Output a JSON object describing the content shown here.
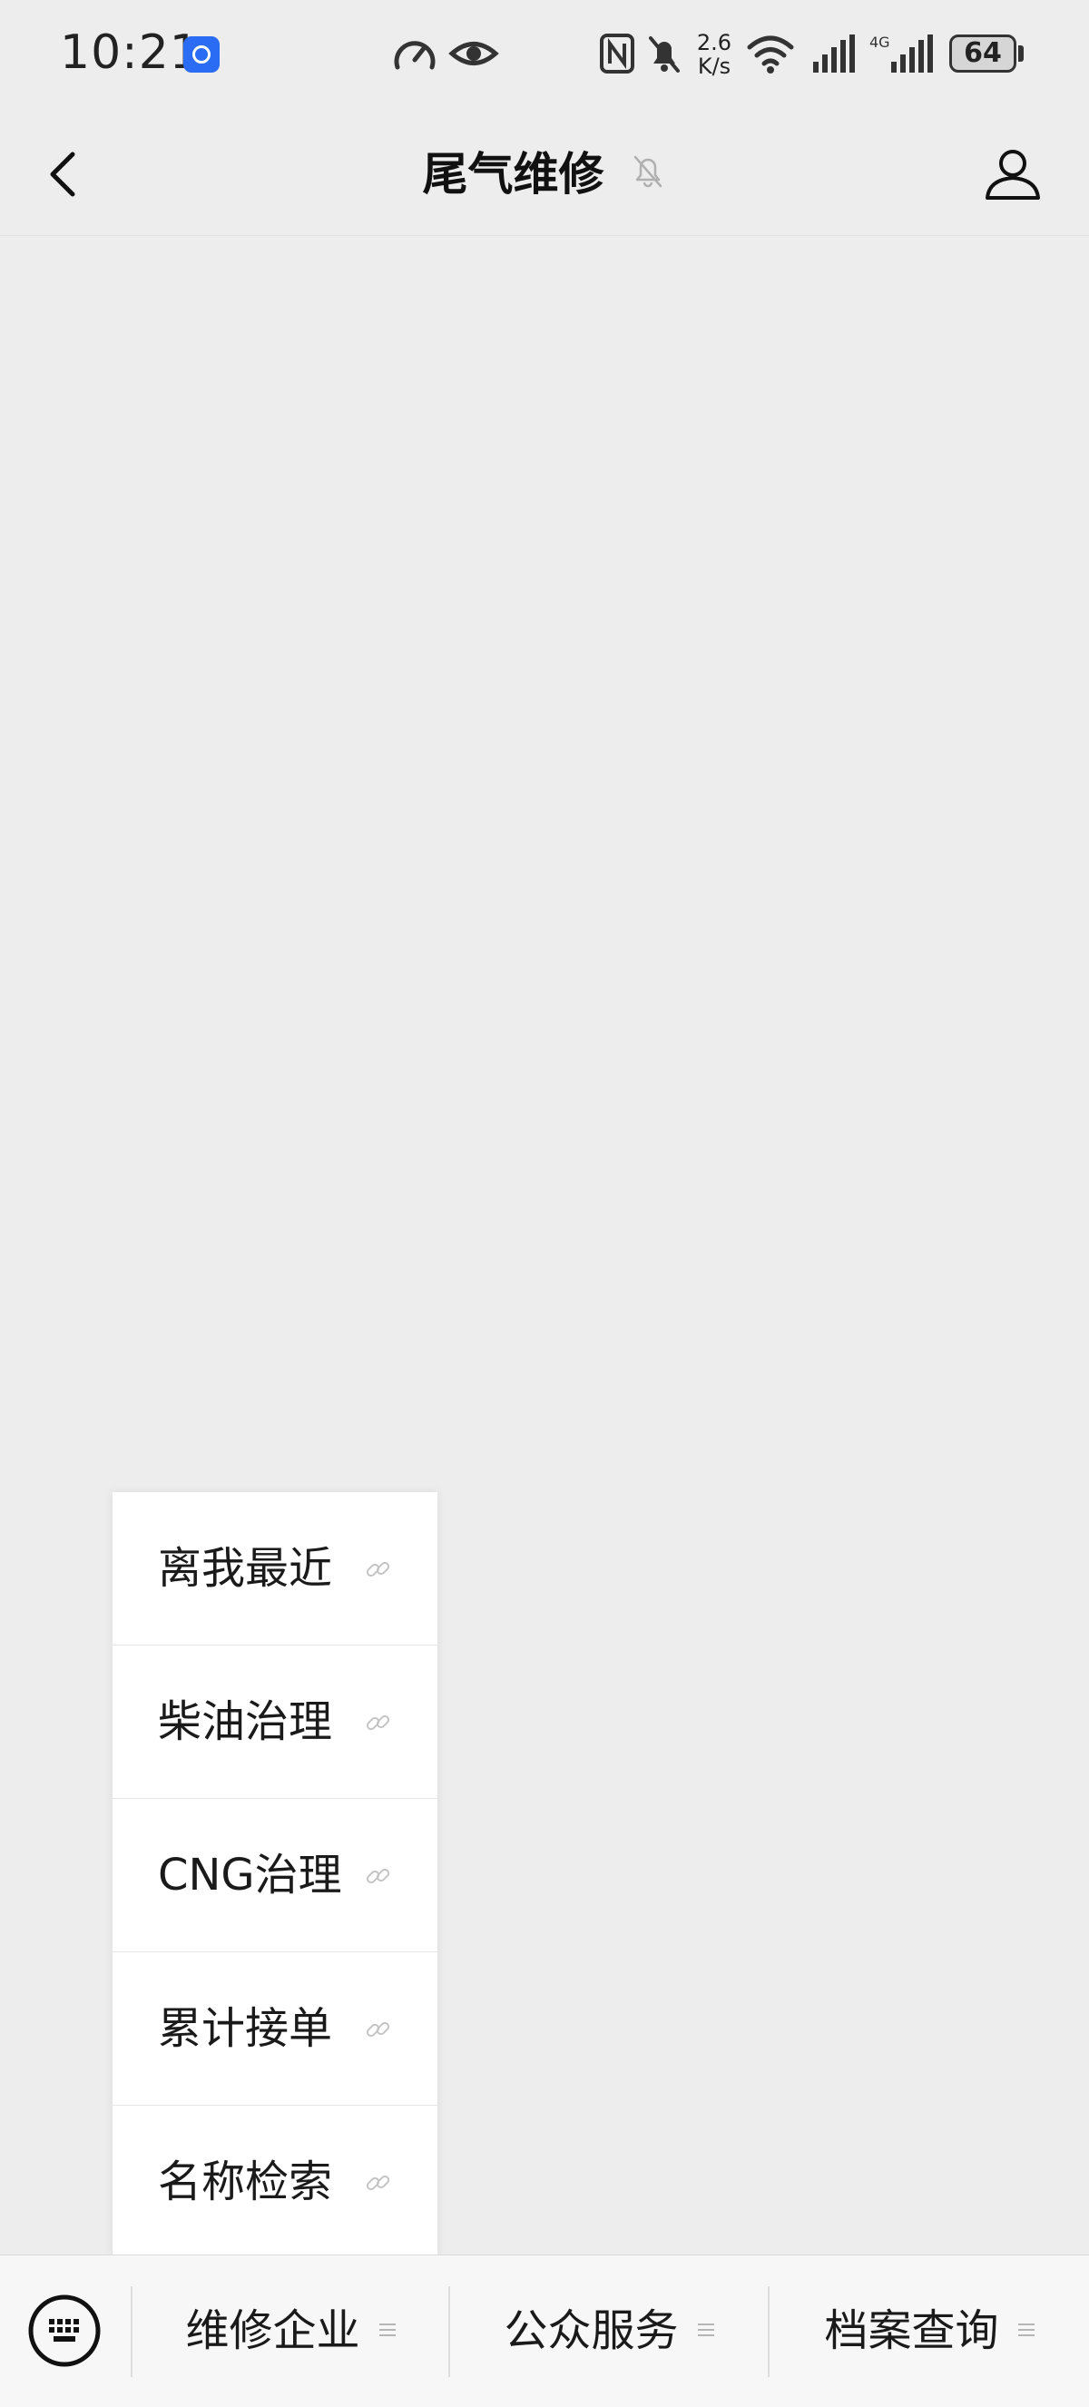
{
  "status_bar": {
    "time": "10:21",
    "net_speed_value": "2.6",
    "net_speed_unit": "K/s",
    "network_type": "4G",
    "battery_level": "64",
    "icons": [
      "app-notification-icon",
      "speedometer-icon",
      "eye-icon",
      "nfc-icon",
      "mute-bell-icon",
      "wifi-icon",
      "signal-icon",
      "signal-4g-icon",
      "battery-icon"
    ]
  },
  "nav": {
    "title": "尾气维修",
    "icons": [
      "back-icon",
      "muted-bell-icon",
      "profile-icon"
    ]
  },
  "sub_menu": {
    "items": [
      {
        "label": "离我最近",
        "icon": "link-icon"
      },
      {
        "label": "柴油治理",
        "icon": "link-icon"
      },
      {
        "label": "CNG治理",
        "icon": "link-icon"
      },
      {
        "label": "累计接单",
        "icon": "link-icon"
      },
      {
        "label": "名称检索",
        "icon": "link-icon"
      }
    ]
  },
  "bottom_menu": {
    "keyboard_icon": "keyboard-icon",
    "tabs": [
      {
        "label": "维修企业",
        "icon": "menu-lines-icon"
      },
      {
        "label": "公众服务",
        "icon": "menu-lines-icon"
      },
      {
        "label": "档案查询",
        "icon": "menu-lines-icon"
      }
    ]
  },
  "colors": {
    "background": "#ededed",
    "menu_background": "#ffffff",
    "bottom_bar": "#f7f7f7",
    "text": "#1a1a1a",
    "icon_gray": "#b5b5b5",
    "badge_blue": "#2a6df4"
  }
}
